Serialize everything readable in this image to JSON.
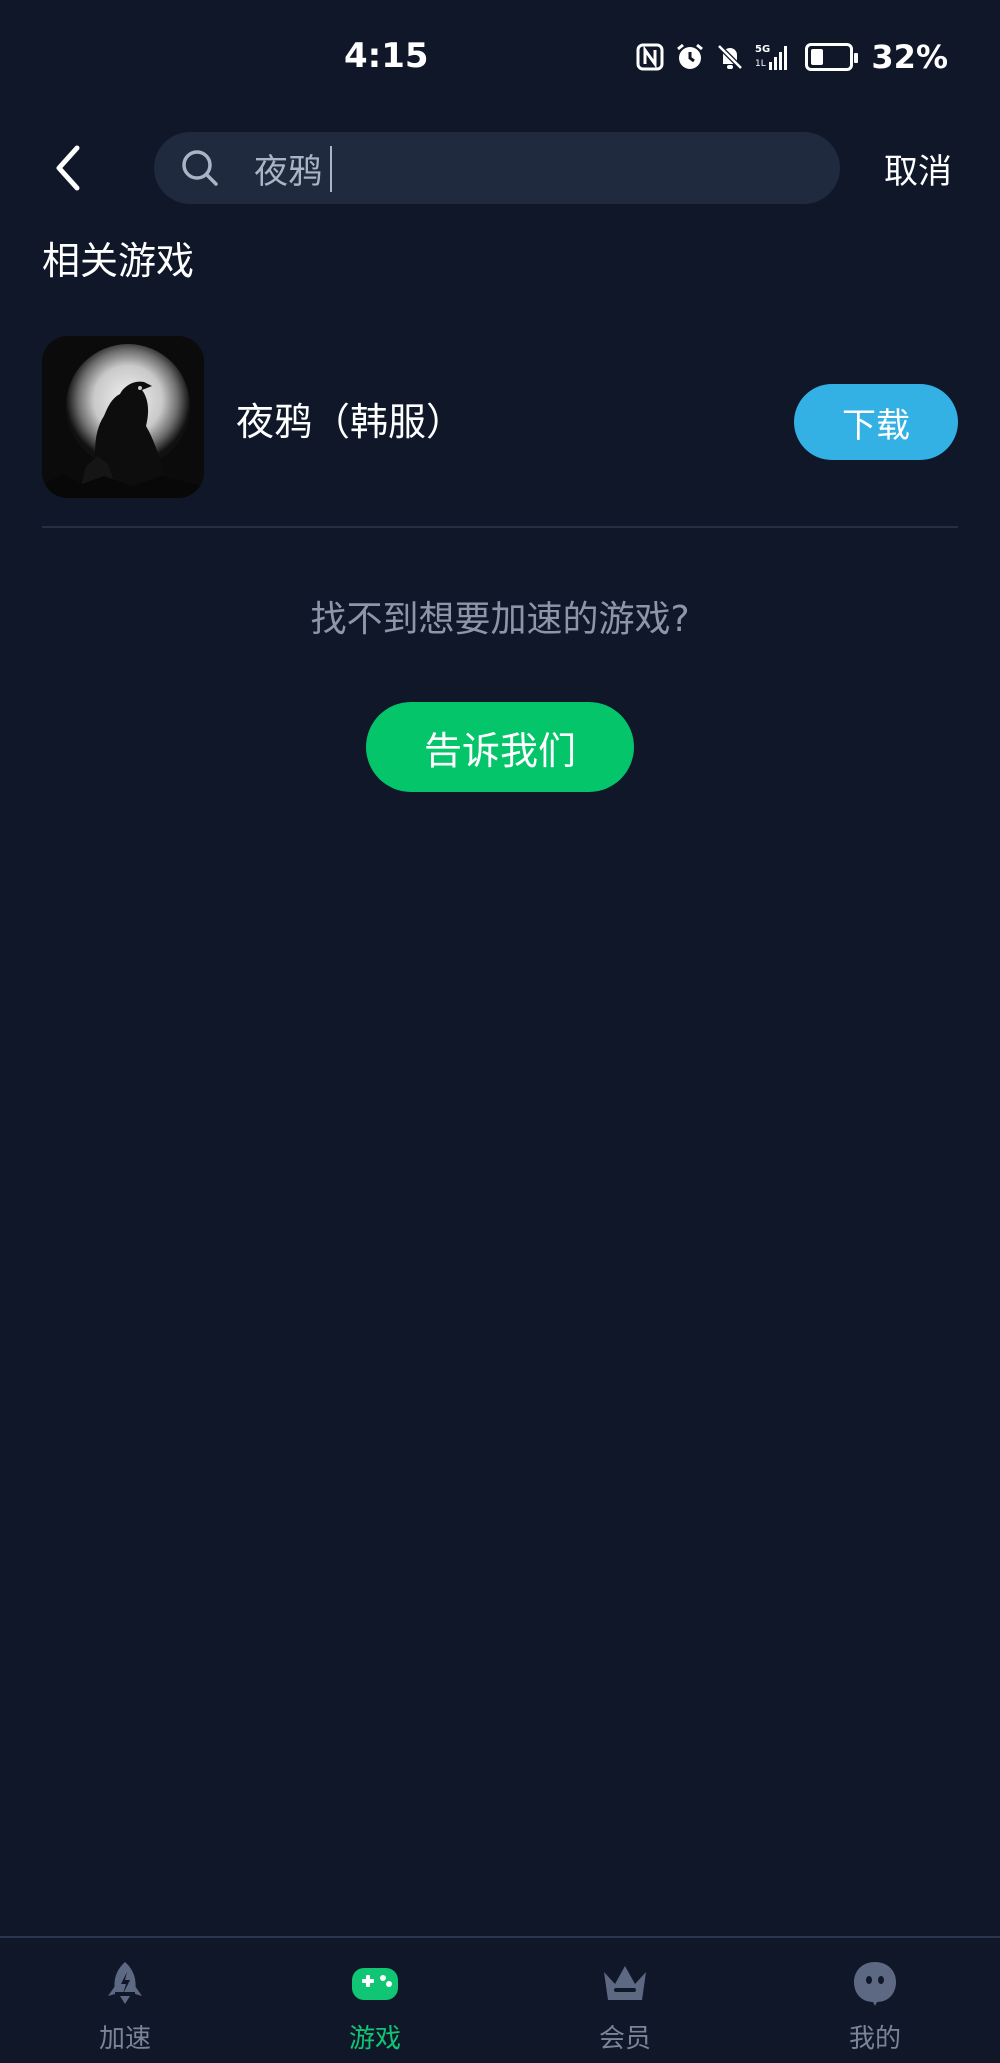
{
  "status_bar": {
    "time": "4:15",
    "battery_percent_text": "32%",
    "battery_level": 0.32,
    "icons": [
      "nfc-icon",
      "alarm-icon",
      "bell-off-icon",
      "signal-5g-icon"
    ]
  },
  "header": {
    "search_value": "夜鸦",
    "cancel_label": "取消"
  },
  "section": {
    "title": "相关游戏"
  },
  "results": [
    {
      "name": "夜鸦（韩服）",
      "action_label": "下载"
    }
  ],
  "notice": {
    "text": "找不到想要加速的游戏?",
    "button_label": "告诉我们"
  },
  "bottom_nav": {
    "items": [
      {
        "label": "加速",
        "icon": "rocket-icon",
        "active": false
      },
      {
        "label": "游戏",
        "icon": "gamepad-icon",
        "active": true
      },
      {
        "label": "会员",
        "icon": "crown-icon",
        "active": false
      },
      {
        "label": "我的",
        "icon": "profile-icon",
        "active": false
      }
    ]
  },
  "colors": {
    "background": "#0f1729",
    "search_bg": "#1f2a3f",
    "download": "#33b1e5",
    "tell_us": "#04c56a",
    "nav_active": "#10c573",
    "nav_inactive": "#7a8499"
  }
}
